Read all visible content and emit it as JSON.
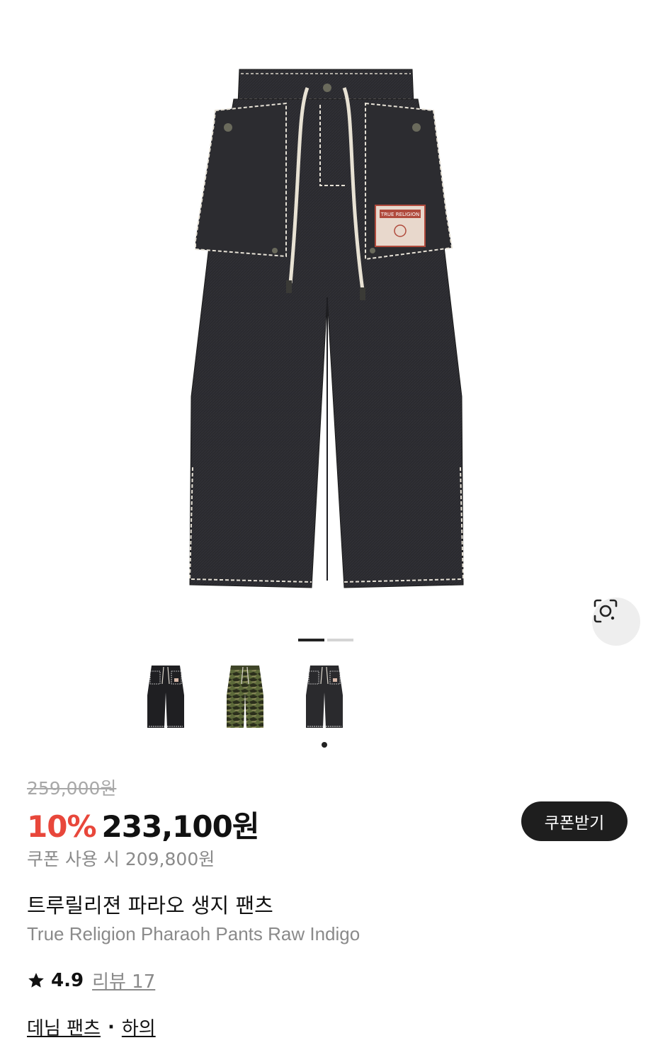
{
  "product": {
    "original_price": "259,000원",
    "discount": "10%",
    "price": "233,100원",
    "coupon_button": "쿠폰받기",
    "coupon_price": "쿠폰 사용 시 209,800원",
    "title_ko": "트루릴리젼 파라오 생지 팬츠",
    "title_en": "True Religion Pharaoh Pants Raw Indigo",
    "rating": "4.9",
    "review_label": "리뷰 17",
    "categories": [
      "데님 팬츠",
      "하의"
    ],
    "patch_text": "TRUE RELIGION"
  },
  "gallery": {
    "pages": 2,
    "active_page": 0,
    "thumbnails": [
      "raw-indigo-pants",
      "camo-pants",
      "raw-indigo-pants-alt"
    ],
    "selected_thumbnail": 2
  },
  "colors": {
    "accent_discount": "#e8473b",
    "button_dark": "#1e1e1e",
    "denim": "#2a2a2d"
  }
}
